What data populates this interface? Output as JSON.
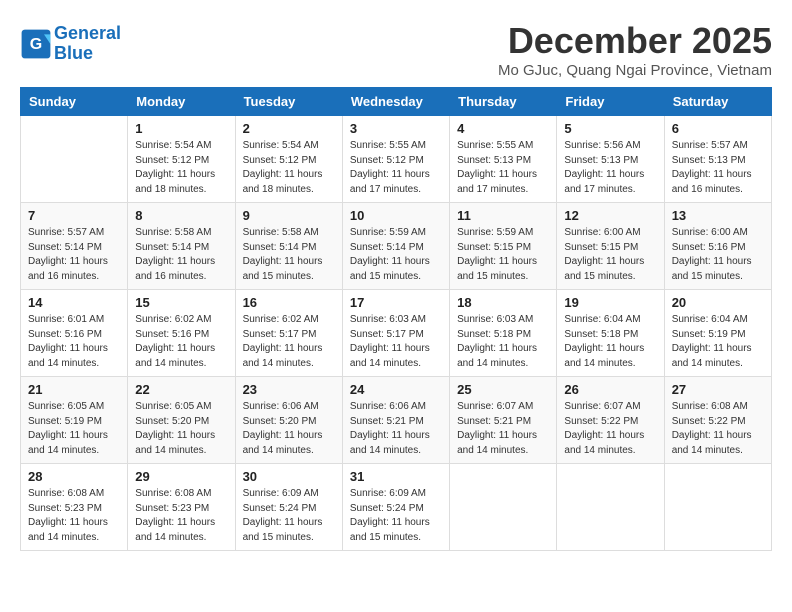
{
  "header": {
    "logo_line1": "General",
    "logo_line2": "Blue",
    "month_title": "December 2025",
    "location": "Mo GJuc, Quang Ngai Province, Vietnam"
  },
  "weekdays": [
    "Sunday",
    "Monday",
    "Tuesday",
    "Wednesday",
    "Thursday",
    "Friday",
    "Saturday"
  ],
  "weeks": [
    [
      {
        "day": "",
        "sunrise": "",
        "sunset": "",
        "daylight": ""
      },
      {
        "day": "1",
        "sunrise": "5:54 AM",
        "sunset": "5:12 PM",
        "daylight": "11 hours and 18 minutes."
      },
      {
        "day": "2",
        "sunrise": "5:54 AM",
        "sunset": "5:12 PM",
        "daylight": "11 hours and 18 minutes."
      },
      {
        "day": "3",
        "sunrise": "5:55 AM",
        "sunset": "5:12 PM",
        "daylight": "11 hours and 17 minutes."
      },
      {
        "day": "4",
        "sunrise": "5:55 AM",
        "sunset": "5:13 PM",
        "daylight": "11 hours and 17 minutes."
      },
      {
        "day": "5",
        "sunrise": "5:56 AM",
        "sunset": "5:13 PM",
        "daylight": "11 hours and 17 minutes."
      },
      {
        "day": "6",
        "sunrise": "5:57 AM",
        "sunset": "5:13 PM",
        "daylight": "11 hours and 16 minutes."
      }
    ],
    [
      {
        "day": "7",
        "sunrise": "5:57 AM",
        "sunset": "5:14 PM",
        "daylight": "11 hours and 16 minutes."
      },
      {
        "day": "8",
        "sunrise": "5:58 AM",
        "sunset": "5:14 PM",
        "daylight": "11 hours and 16 minutes."
      },
      {
        "day": "9",
        "sunrise": "5:58 AM",
        "sunset": "5:14 PM",
        "daylight": "11 hours and 15 minutes."
      },
      {
        "day": "10",
        "sunrise": "5:59 AM",
        "sunset": "5:14 PM",
        "daylight": "11 hours and 15 minutes."
      },
      {
        "day": "11",
        "sunrise": "5:59 AM",
        "sunset": "5:15 PM",
        "daylight": "11 hours and 15 minutes."
      },
      {
        "day": "12",
        "sunrise": "6:00 AM",
        "sunset": "5:15 PM",
        "daylight": "11 hours and 15 minutes."
      },
      {
        "day": "13",
        "sunrise": "6:00 AM",
        "sunset": "5:16 PM",
        "daylight": "11 hours and 15 minutes."
      }
    ],
    [
      {
        "day": "14",
        "sunrise": "6:01 AM",
        "sunset": "5:16 PM",
        "daylight": "11 hours and 14 minutes."
      },
      {
        "day": "15",
        "sunrise": "6:02 AM",
        "sunset": "5:16 PM",
        "daylight": "11 hours and 14 minutes."
      },
      {
        "day": "16",
        "sunrise": "6:02 AM",
        "sunset": "5:17 PM",
        "daylight": "11 hours and 14 minutes."
      },
      {
        "day": "17",
        "sunrise": "6:03 AM",
        "sunset": "5:17 PM",
        "daylight": "11 hours and 14 minutes."
      },
      {
        "day": "18",
        "sunrise": "6:03 AM",
        "sunset": "5:18 PM",
        "daylight": "11 hours and 14 minutes."
      },
      {
        "day": "19",
        "sunrise": "6:04 AM",
        "sunset": "5:18 PM",
        "daylight": "11 hours and 14 minutes."
      },
      {
        "day": "20",
        "sunrise": "6:04 AM",
        "sunset": "5:19 PM",
        "daylight": "11 hours and 14 minutes."
      }
    ],
    [
      {
        "day": "21",
        "sunrise": "6:05 AM",
        "sunset": "5:19 PM",
        "daylight": "11 hours and 14 minutes."
      },
      {
        "day": "22",
        "sunrise": "6:05 AM",
        "sunset": "5:20 PM",
        "daylight": "11 hours and 14 minutes."
      },
      {
        "day": "23",
        "sunrise": "6:06 AM",
        "sunset": "5:20 PM",
        "daylight": "11 hours and 14 minutes."
      },
      {
        "day": "24",
        "sunrise": "6:06 AM",
        "sunset": "5:21 PM",
        "daylight": "11 hours and 14 minutes."
      },
      {
        "day": "25",
        "sunrise": "6:07 AM",
        "sunset": "5:21 PM",
        "daylight": "11 hours and 14 minutes."
      },
      {
        "day": "26",
        "sunrise": "6:07 AM",
        "sunset": "5:22 PM",
        "daylight": "11 hours and 14 minutes."
      },
      {
        "day": "27",
        "sunrise": "6:08 AM",
        "sunset": "5:22 PM",
        "daylight": "11 hours and 14 minutes."
      }
    ],
    [
      {
        "day": "28",
        "sunrise": "6:08 AM",
        "sunset": "5:23 PM",
        "daylight": "11 hours and 14 minutes."
      },
      {
        "day": "29",
        "sunrise": "6:08 AM",
        "sunset": "5:23 PM",
        "daylight": "11 hours and 14 minutes."
      },
      {
        "day": "30",
        "sunrise": "6:09 AM",
        "sunset": "5:24 PM",
        "daylight": "11 hours and 15 minutes."
      },
      {
        "day": "31",
        "sunrise": "6:09 AM",
        "sunset": "5:24 PM",
        "daylight": "11 hours and 15 minutes."
      },
      {
        "day": "",
        "sunrise": "",
        "sunset": "",
        "daylight": ""
      },
      {
        "day": "",
        "sunrise": "",
        "sunset": "",
        "daylight": ""
      },
      {
        "day": "",
        "sunrise": "",
        "sunset": "",
        "daylight": ""
      }
    ]
  ]
}
